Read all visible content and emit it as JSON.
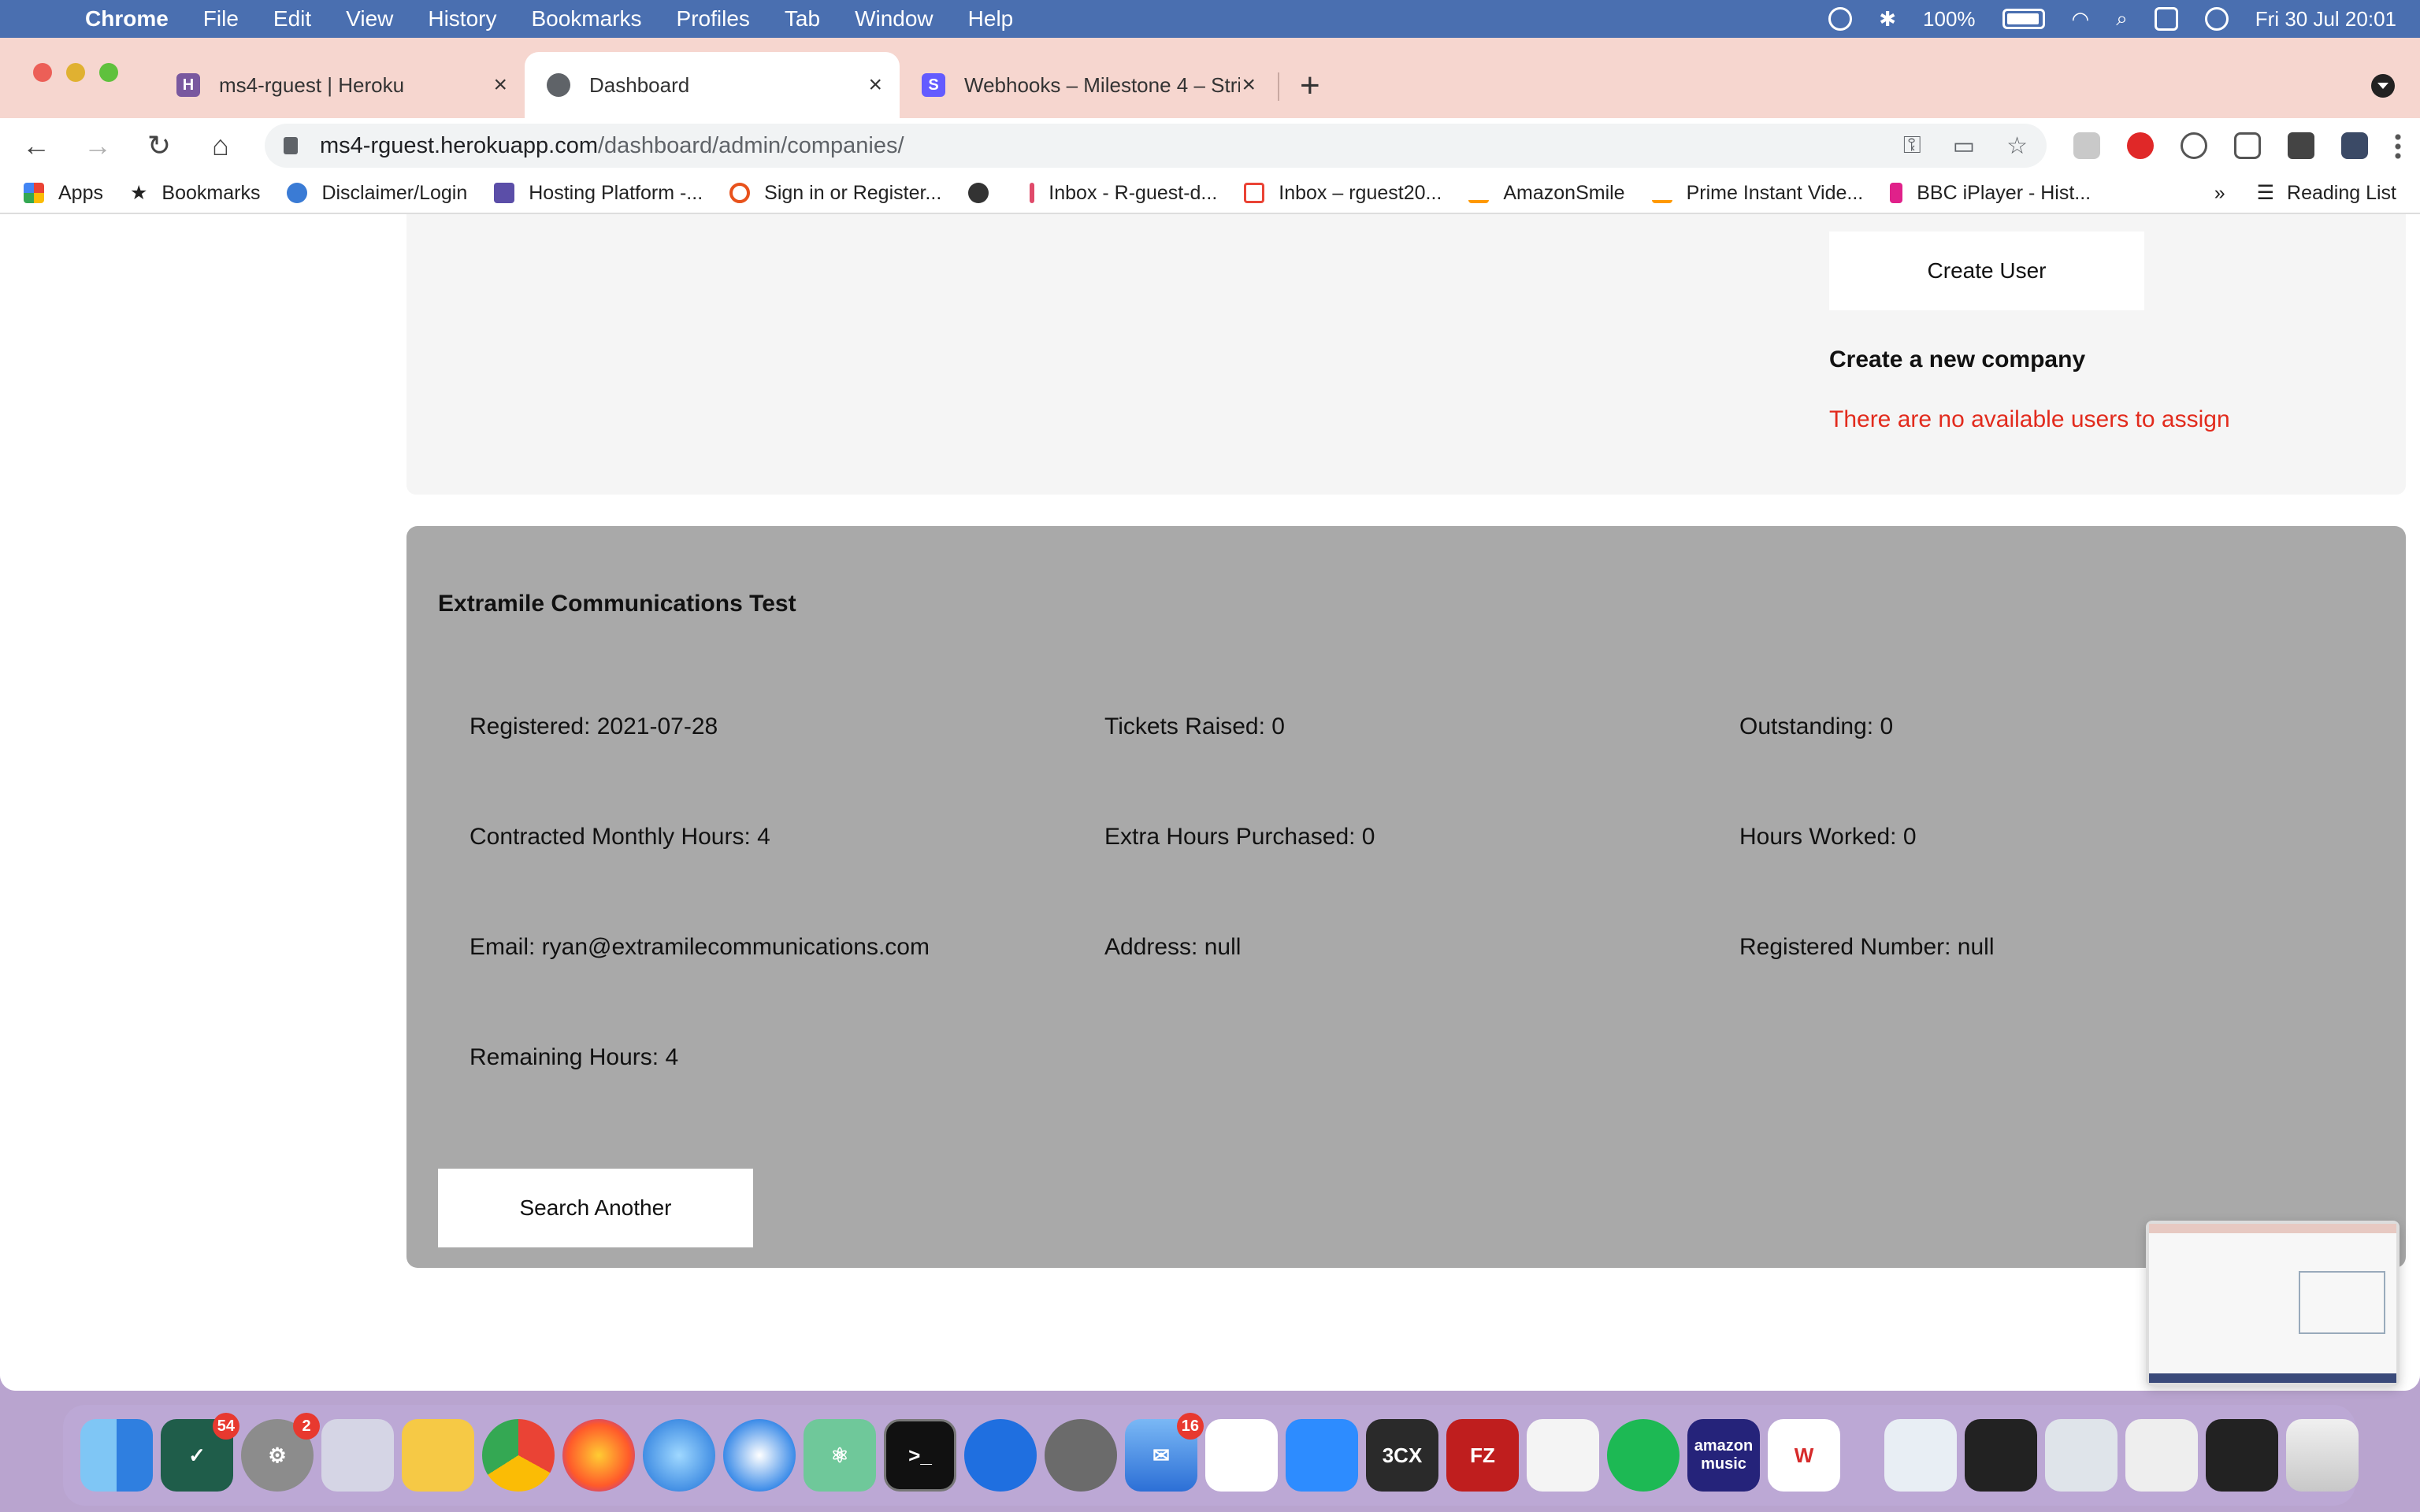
{
  "menubar": {
    "app": "Chrome",
    "items": [
      "File",
      "Edit",
      "View",
      "History",
      "Bookmarks",
      "Profiles",
      "Tab",
      "Window",
      "Help"
    ],
    "battery": "100%",
    "datetime": "Fri 30 Jul  20:01"
  },
  "tabs": [
    {
      "title": "ms4-rguest | Heroku",
      "icon": "heroku-icon",
      "color": "#79589f"
    },
    {
      "title": "Dashboard",
      "icon": "globe-icon",
      "color": "#5f6368"
    },
    {
      "title": "Webhooks – Milestone 4 – Stri",
      "icon": "stripe-icon",
      "color": "#635bff"
    }
  ],
  "address": {
    "host": "ms4-rguest.herokuapp.com",
    "path": "/dashboard/admin/companies/"
  },
  "bookmarks": [
    {
      "label": "Apps",
      "icon": "apps-grid-icon"
    },
    {
      "label": "Bookmarks",
      "icon": "star-icon"
    },
    {
      "label": "Disclaimer/Login",
      "icon": "site-icon"
    },
    {
      "label": "Hosting Platform -...",
      "icon": "heroku-icon"
    },
    {
      "label": "Sign in or Register...",
      "icon": "ring-icon"
    },
    {
      "label": "",
      "icon": "globe-icon"
    },
    {
      "label": "Inbox - R-guest-d...",
      "icon": "mail-icon"
    },
    {
      "label": "Inbox – rguest20...",
      "icon": "gmail-icon"
    },
    {
      "label": "AmazonSmile",
      "icon": "amazon-icon"
    },
    {
      "label": "Prime Instant Vide...",
      "icon": "amazon-icon"
    },
    {
      "label": "BBC iPlayer - Hist...",
      "icon": "iplayer-icon"
    }
  ],
  "reading_list": "Reading List",
  "more_bookmarks": "»",
  "top_card": {
    "create_user_button": "Create User",
    "create_company_title": "Create a new company",
    "no_users_message": "There are no available users to assign"
  },
  "company": {
    "name": "Extramile Communications Test",
    "registered": "Registered: 2021-07-28",
    "tickets_raised": "Tickets Raised: 0",
    "outstanding": "Outstanding: 0",
    "contracted_hours": "Contracted Monthly Hours: 4",
    "extra_hours": "Extra Hours Purchased: 0",
    "hours_worked": "Hours Worked: 0",
    "email": "Email: ryan@extramilecommunications.com",
    "address": "Address: null",
    "registered_number": "Registered Number: null",
    "remaining_hours": "Remaining Hours: 4",
    "search_another_button": "Search Another"
  },
  "dock": {
    "badges": {
      "things": "54",
      "settings": "2",
      "mail": "16"
    },
    "labels": {
      "threecx": "3CX",
      "filezilla": "FZ",
      "amazon_music": "amazon music"
    }
  },
  "colors": {
    "error_text": "#e22b1d",
    "company_card_bg": "#a9a9a9",
    "tabstrip_bg": "#f6d6cf"
  }
}
